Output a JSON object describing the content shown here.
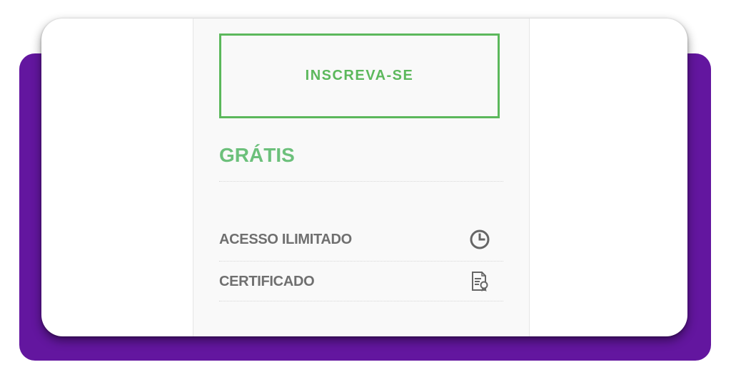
{
  "colors": {
    "backdrop": "#63169f",
    "accent_green": "#5cb85c",
    "price_green": "#6cc07b",
    "feature_text": "#6f6f6f"
  },
  "cta": {
    "label": "INSCREVA-SE"
  },
  "price": {
    "label": "GRÁTIS"
  },
  "features": [
    {
      "label": "ACESSO ILIMITADO",
      "icon": "clock-icon"
    },
    {
      "label": "CERTIFICADO",
      "icon": "certificate-icon"
    }
  ]
}
